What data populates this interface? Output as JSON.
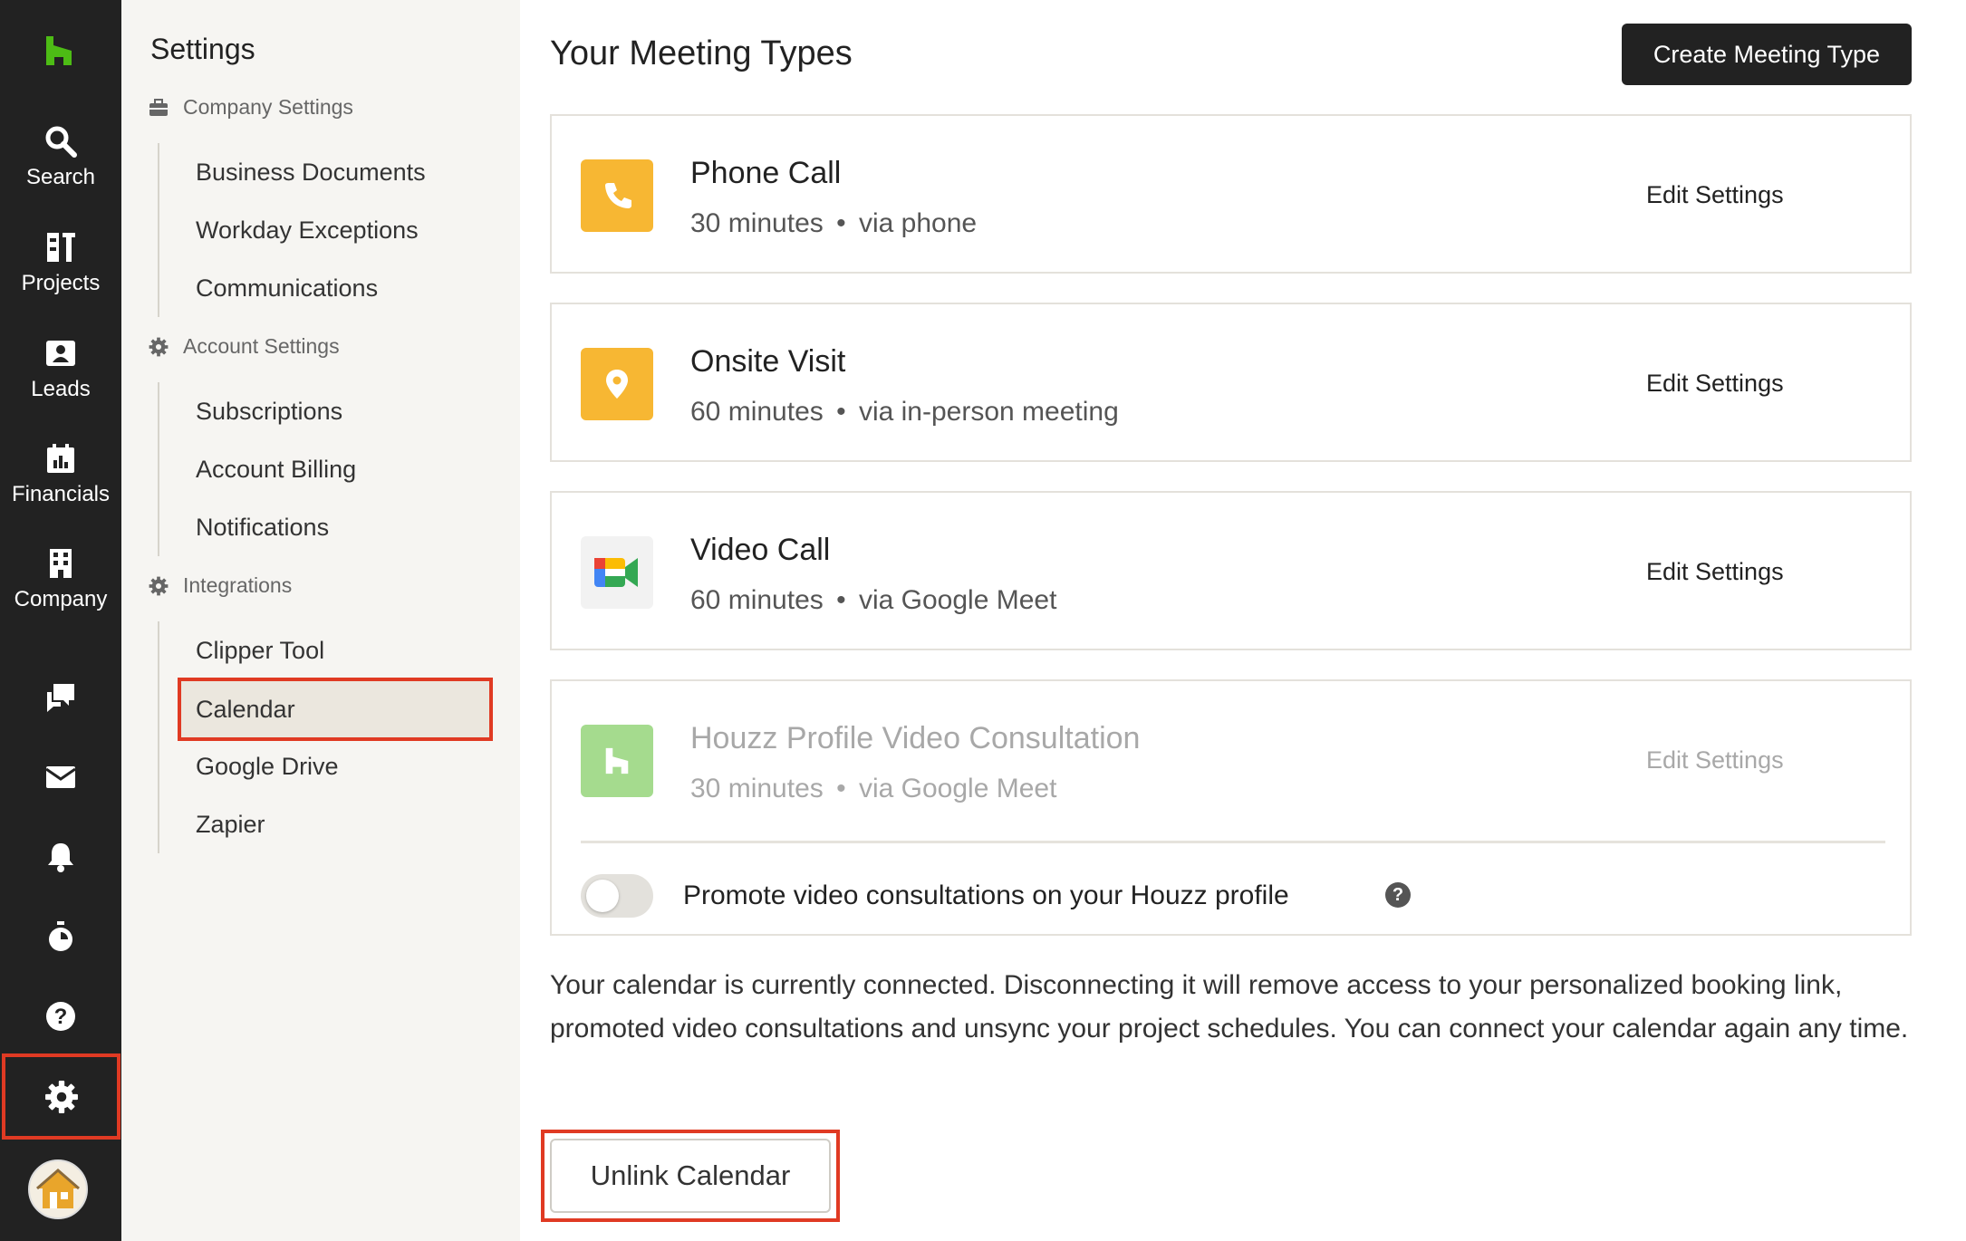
{
  "rail": {
    "items": [
      {
        "label": "Search",
        "icon": "search-icon"
      },
      {
        "label": "Projects",
        "icon": "projects-icon"
      },
      {
        "label": "Leads",
        "icon": "leads-icon"
      },
      {
        "label": "Financials",
        "icon": "financials-icon"
      },
      {
        "label": "Company",
        "icon": "company-icon"
      }
    ],
    "icons": [
      "messages-icon",
      "inbox-icon",
      "bell-icon",
      "timer-icon",
      "help-icon",
      "gear-icon"
    ]
  },
  "sidebar": {
    "title": "Settings",
    "sections": [
      {
        "label": "Company Settings",
        "icon": "briefcase-icon",
        "items": [
          "Business Documents",
          "Workday Exceptions",
          "Communications"
        ]
      },
      {
        "label": "Account Settings",
        "icon": "gear-icon",
        "items": [
          "Subscriptions",
          "Account Billing",
          "Notifications"
        ]
      },
      {
        "label": "Integrations",
        "icon": "gear-icon",
        "items": [
          "Clipper Tool",
          "Calendar",
          "Google Drive",
          "Zapier"
        ]
      }
    ],
    "active_item": "Calendar"
  },
  "main": {
    "title": "Your Meeting Types",
    "create_button": "Create Meeting Type",
    "meeting_types": [
      {
        "name": "Phone Call",
        "duration": "30 minutes",
        "via": "via phone",
        "edit": "Edit Settings",
        "icon": "phone-icon",
        "color": "#f7b733"
      },
      {
        "name": "Onsite Visit",
        "duration": "60 minutes",
        "via": "via in-person meeting",
        "edit": "Edit Settings",
        "icon": "location-pin-icon",
        "color": "#f7b733"
      },
      {
        "name": "Video Call",
        "duration": "60 minutes",
        "via": "via Google Meet",
        "edit": "Edit Settings",
        "icon": "google-meet-icon",
        "color": "#f2f2f2"
      },
      {
        "name": "Houzz Profile Video Consultation",
        "duration": "30 minutes",
        "via": "via Google Meet",
        "edit": "Edit Settings",
        "icon": "houzz-icon",
        "color": "#a5db8e"
      }
    ],
    "separator": "•",
    "promote_label": "Promote video consultations on your Houzz profile",
    "promote_enabled": false,
    "help_mark": "?",
    "info_text": "Your calendar is currently connected. Disconnecting it will remove access to your personalized booking link, promoted video consultations and unsync your project schedules. You can connect your calendar again any time.",
    "unlink_button": "Unlink Calendar"
  },
  "colors": {
    "rail_bg": "#222222",
    "brand_green": "#4dbc15",
    "highlight_red": "#e03a23",
    "sidebar_bg": "#f6f5f2"
  }
}
